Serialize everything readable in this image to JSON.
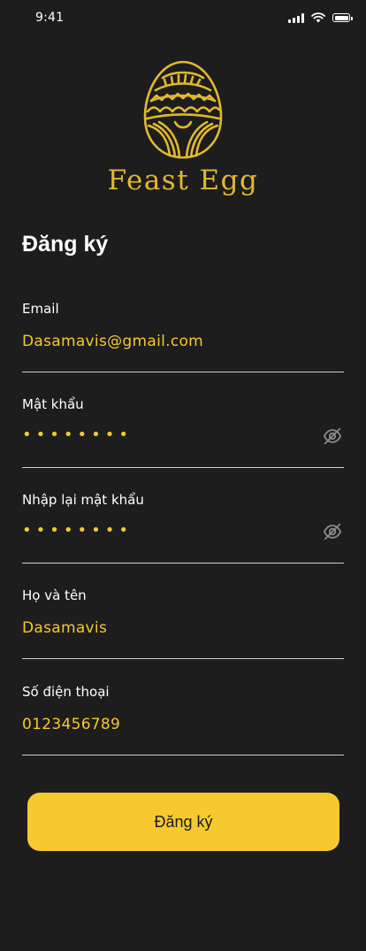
{
  "status_bar": {
    "time": "9:41",
    "icons": [
      "cellular-signal-icon",
      "wifi-icon",
      "battery-icon"
    ]
  },
  "logo": {
    "text": "Feast Egg",
    "icon": "egg-logo-icon",
    "color": "#e2b92d"
  },
  "page": {
    "title": "Đăng ký"
  },
  "form": {
    "email": {
      "label": "Email",
      "value": "Dasamavis@gmail.com"
    },
    "password": {
      "label": "Mật khẩu",
      "value": "••••••••",
      "toggle_icon": "eye-off-icon"
    },
    "confirm_password": {
      "label": "Nhập lại mật khẩu",
      "value": "••••••••",
      "toggle_icon": "eye-off-icon"
    },
    "full_name": {
      "label": "Họ và tên",
      "value": "Dasamavis"
    },
    "phone": {
      "label": "Số điện thoại",
      "value": "0123456789"
    }
  },
  "submit": {
    "label": "Đăng ký"
  },
  "colors": {
    "background": "#1d1d1d",
    "accent": "#f7c92f",
    "value_text": "#f5c92c",
    "divider": "#cfcfcf"
  }
}
